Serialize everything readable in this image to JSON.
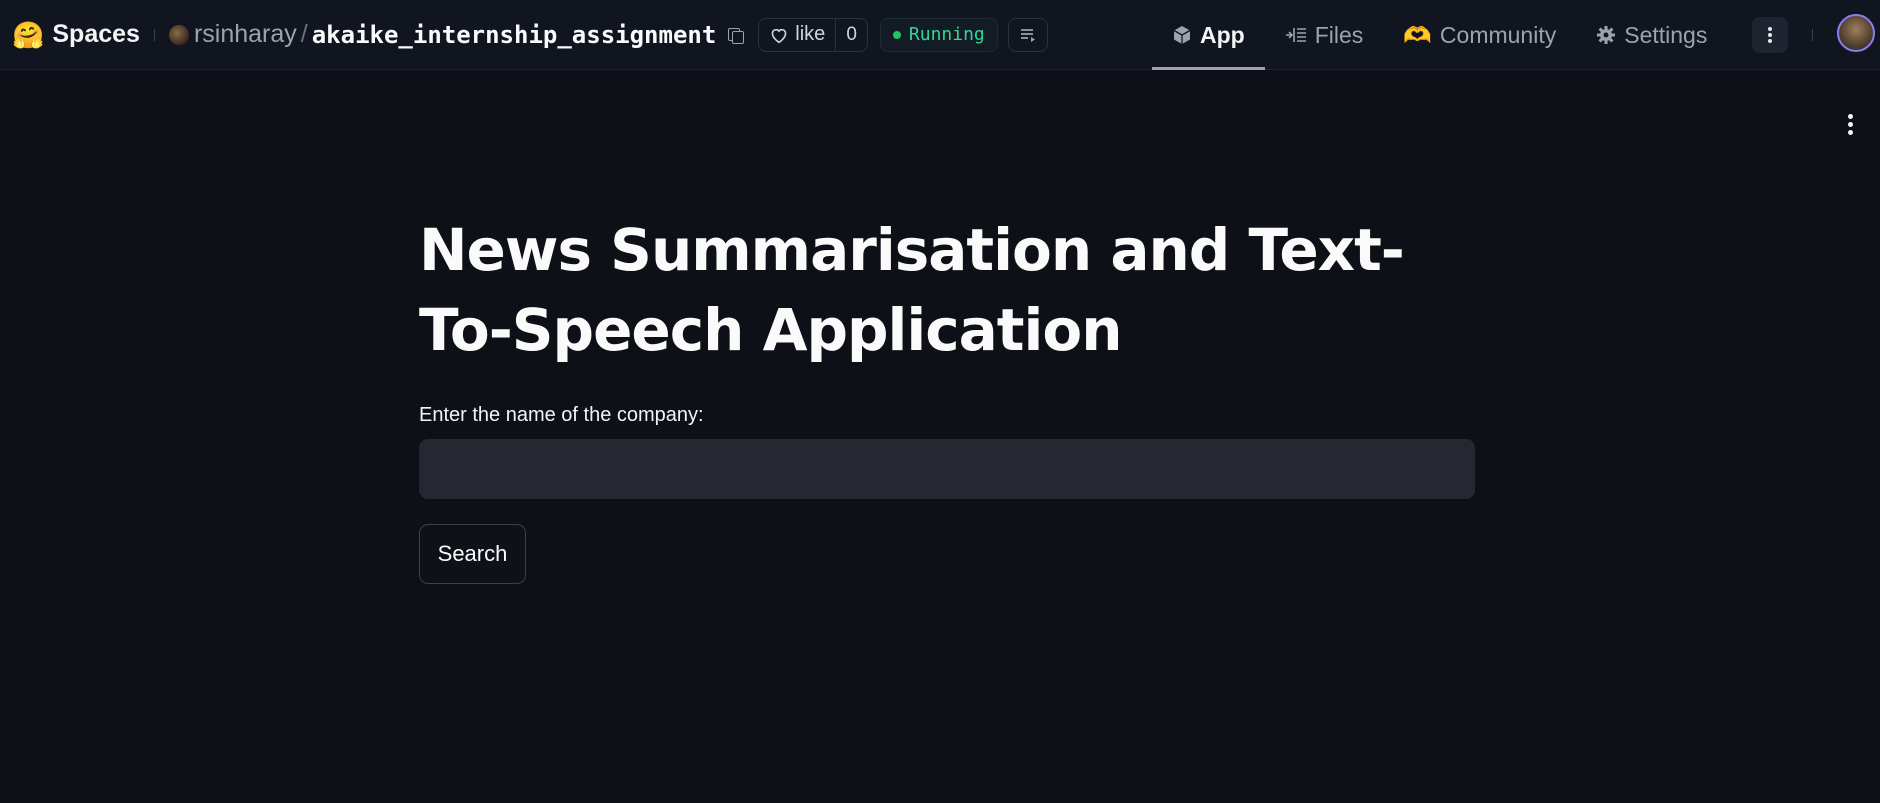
{
  "header": {
    "brand_emoji": "🤗",
    "brand_label": "Spaces",
    "owner": "rsinharay",
    "separator": "/",
    "repo": "akaike_internship_assignment",
    "like_label": "like",
    "like_count": "0",
    "status": "Running",
    "status_color": "#22c55e"
  },
  "nav": {
    "app": "App",
    "files": "Files",
    "community_emoji": "🫶",
    "community": "Community",
    "settings": "Settings"
  },
  "main": {
    "title": "News Summarisation and Text-To-Speech Application",
    "input_label": "Enter the name of the company:",
    "input_value": "",
    "search_button": "Search"
  }
}
